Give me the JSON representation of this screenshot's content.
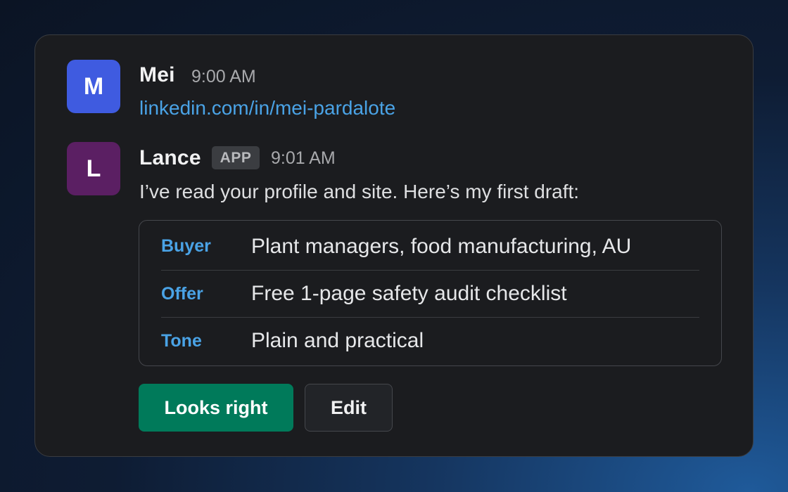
{
  "messages": [
    {
      "avatar_letter": "M",
      "avatar_color": "#3f5be0",
      "author": "Mei",
      "time": "9:00 AM",
      "link": "linkedin.com/in/mei-pardalote"
    },
    {
      "avatar_letter": "L",
      "avatar_color": "#5b1f63",
      "author": "Lance",
      "badge": "APP",
      "time": "9:01 AM",
      "text": "I’ve read your profile and site. Here’s my first draft:",
      "draft": [
        {
          "key": "Buyer",
          "value": "Plant managers, food manufacturing, AU"
        },
        {
          "key": "Offer",
          "value": "Free 1-page safety audit checklist"
        },
        {
          "key": "Tone",
          "value": "Plain and practical"
        }
      ],
      "actions": {
        "primary_label": "Looks right",
        "secondary_label": "Edit"
      }
    }
  ],
  "colors": {
    "accent_link": "#4aa3e6",
    "primary_button": "#007a5a"
  }
}
